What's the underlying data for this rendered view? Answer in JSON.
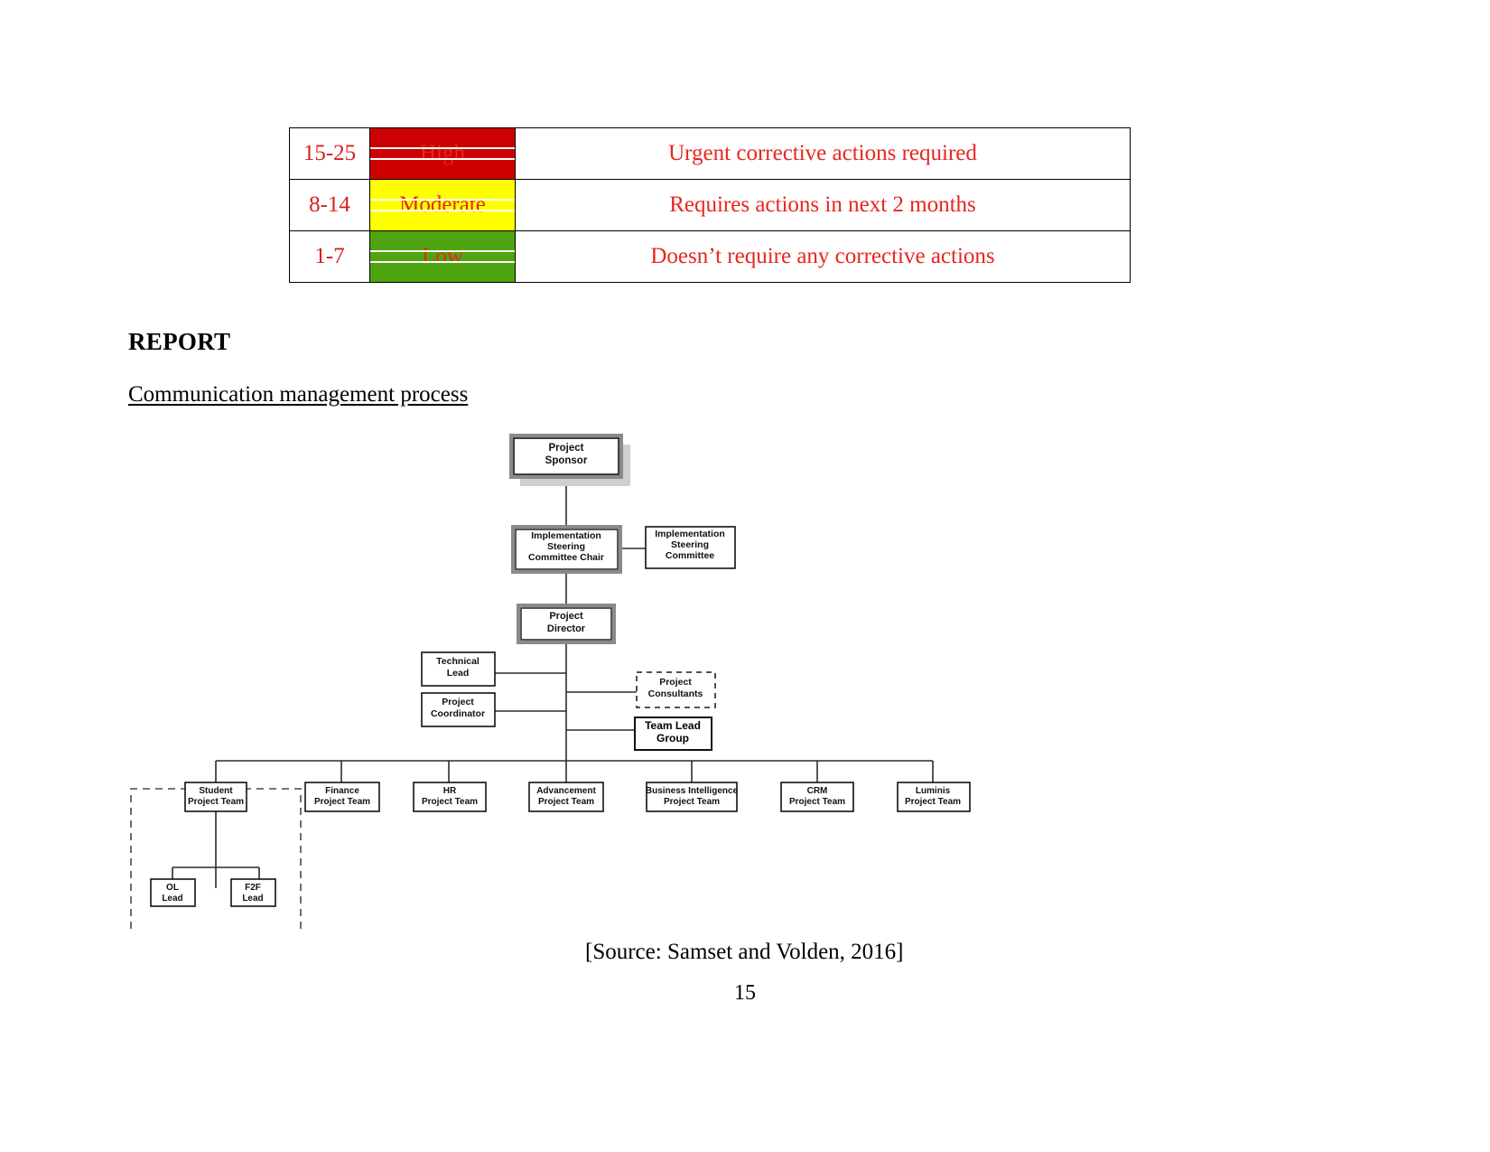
{
  "risk_table": {
    "rows": [
      {
        "range": "15-25",
        "level": "High",
        "level_color": "#cc0000",
        "description": "Urgent corrective actions required"
      },
      {
        "range": "8-14",
        "level": "Moderate",
        "level_color": "#ffff00",
        "description": "Requires actions in next 2 months"
      },
      {
        "range": "1-7",
        "level": "Low",
        "level_color": "#4ea50f",
        "description": "Doesn’t require any corrective actions"
      }
    ]
  },
  "headings": {
    "report": "REPORT",
    "subtitle": "Communication management process "
  },
  "org_chart": {
    "nodes": {
      "project_sponsor": "Project\nSponsor",
      "project_sponsor_line1": "Project",
      "project_sponsor_line2": "Sponsor",
      "steering_chair_line1": "Implementation",
      "steering_chair_line2": "Steering",
      "steering_chair_line3": "Committee Chair",
      "steering_committee_line1": "Implementation",
      "steering_committee_line2": "Steering",
      "steering_committee_line3": "Committee",
      "project_director_line1": "Project",
      "project_director_line2": "Director",
      "technical_lead_line1": "Technical",
      "technical_lead_line2": "Lead",
      "project_coordinator_line1": "Project",
      "project_coordinator_line2": "Coordinator",
      "project_consultants_line1": "Project",
      "project_consultants_line2": "Consultants",
      "team_lead_group_line1": "Team Lead",
      "team_lead_group_line2": "Group",
      "ol_lead_line1": "OL",
      "ol_lead_line2": "Lead",
      "f2f_lead_line1": "F2F",
      "f2f_lead_line2": "Lead"
    },
    "teams": [
      {
        "line1": "Student",
        "line2": "Project Team"
      },
      {
        "line1": "Finance",
        "line2": "Project Team"
      },
      {
        "line1": "HR",
        "line2": "Project Team"
      },
      {
        "line1": "Advancement",
        "line2": "Project Team"
      },
      {
        "line1": "Business Intelligence",
        "line2": "Project Team"
      },
      {
        "line1": "CRM",
        "line2": "Project Team"
      },
      {
        "line1": "Luminis",
        "line2": "Project Team"
      }
    ]
  },
  "footer": {
    "source": "[Source: Samset and Volden, 2016]",
    "page_number": "15"
  }
}
